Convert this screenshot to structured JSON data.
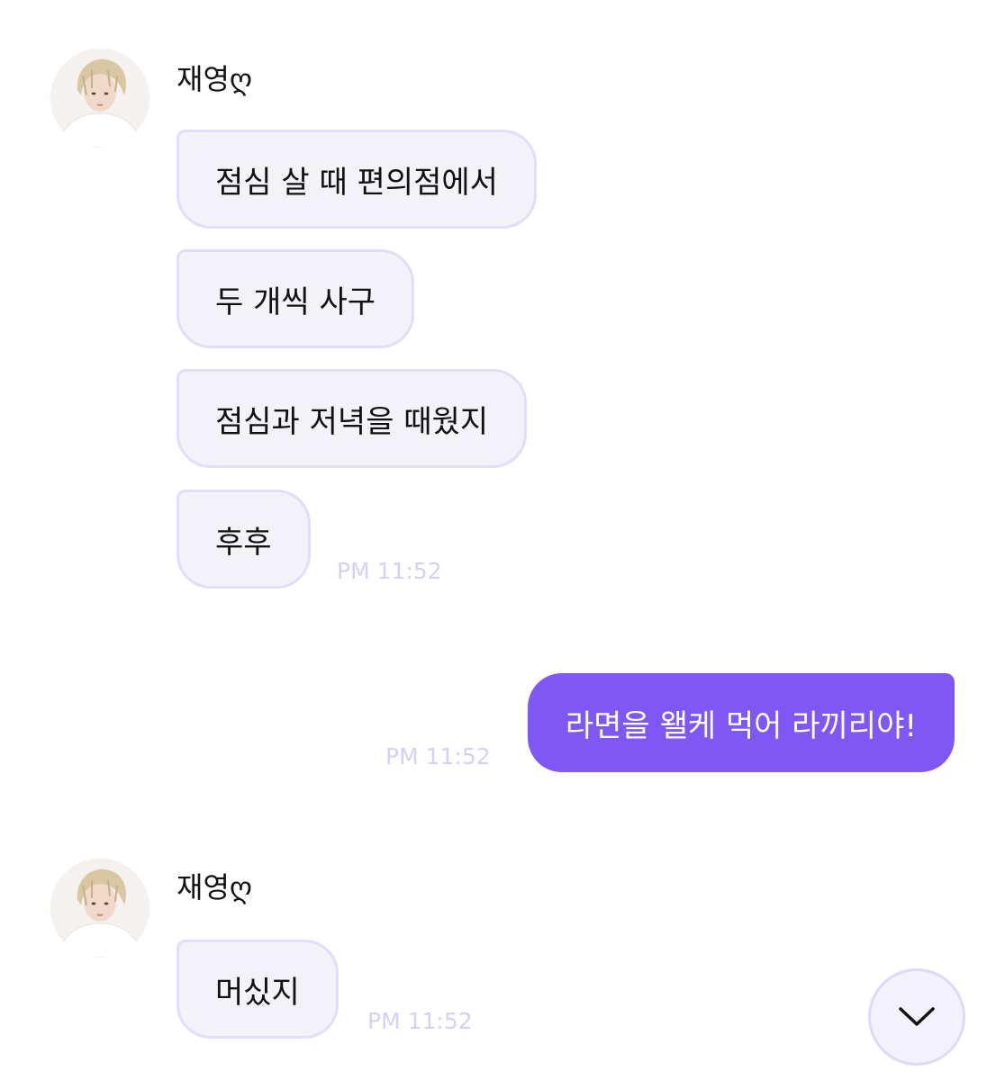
{
  "messages": [
    {
      "sender": "재영ღ",
      "bubbles": [
        "점심 살 때 편의점에서",
        "두 개씩 사구",
        "점심과 저녁을 때웠지",
        "후후"
      ],
      "time": "PM 11:52"
    },
    {
      "mine": true,
      "bubbles": [
        "라면을 왤케 먹어 라끼리야!"
      ],
      "time": "PM 11:52"
    },
    {
      "sender": "재영ღ",
      "bubbles": [
        "머싰지"
      ],
      "time": "PM 11:52"
    }
  ],
  "scroll_button": {
    "icon": "chevron-down-icon"
  },
  "colors": {
    "my_bubble": "#7f57f5",
    "their_bubble": "#f3f2f8",
    "their_bubble_border": "#e3dcfb",
    "timestamp": "#d6cff6"
  }
}
